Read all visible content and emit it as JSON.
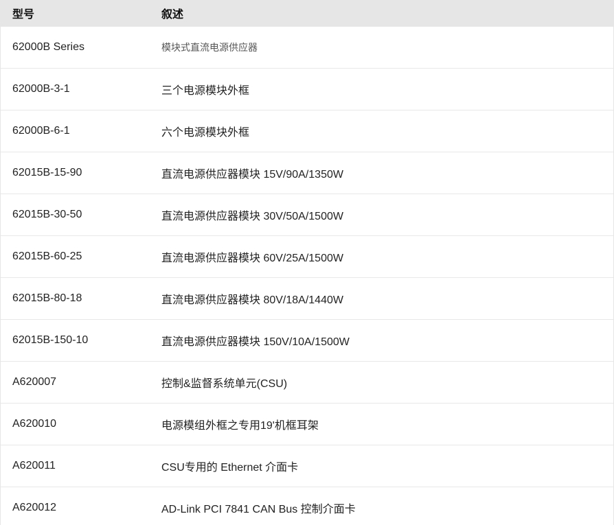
{
  "table": {
    "headers": {
      "model": "型号",
      "description": "叙述"
    },
    "rows": [
      {
        "model": "62000B Series",
        "description": "模块式直流电源供应器"
      },
      {
        "model": "62000B-3-1",
        "description": "三个电源模块外框"
      },
      {
        "model": "62000B-6-1",
        "description": "六个电源模块外框"
      },
      {
        "model": "62015B-15-90",
        "description": "直流电源供应器模块 15V/90A/1350W"
      },
      {
        "model": "62015B-30-50",
        "description": "直流电源供应器模块 30V/50A/1500W"
      },
      {
        "model": "62015B-60-25",
        "description": "直流电源供应器模块 60V/25A/1500W"
      },
      {
        "model": "62015B-80-18",
        "description": "直流电源供应器模块 80V/18A/1440W"
      },
      {
        "model": "62015B-150-10",
        "description": "直流电源供应器模块 150V/10A/1500W"
      },
      {
        "model": "A620007",
        "description": "控制&监督系统单元(CSU)"
      },
      {
        "model": "A620010",
        "description": "电源模组外框之专用19'机框耳架"
      },
      {
        "model": "A620011",
        "description": " CSU专用的 Ethernet 介面卡"
      },
      {
        "model": "A620012",
        "description": "AD-Link PCI 7841 CAN Bus 控制介面卡"
      }
    ]
  },
  "colors": {
    "header_bg": "#e6e6e6",
    "border": "#e8e8e8",
    "text": "#222222"
  }
}
